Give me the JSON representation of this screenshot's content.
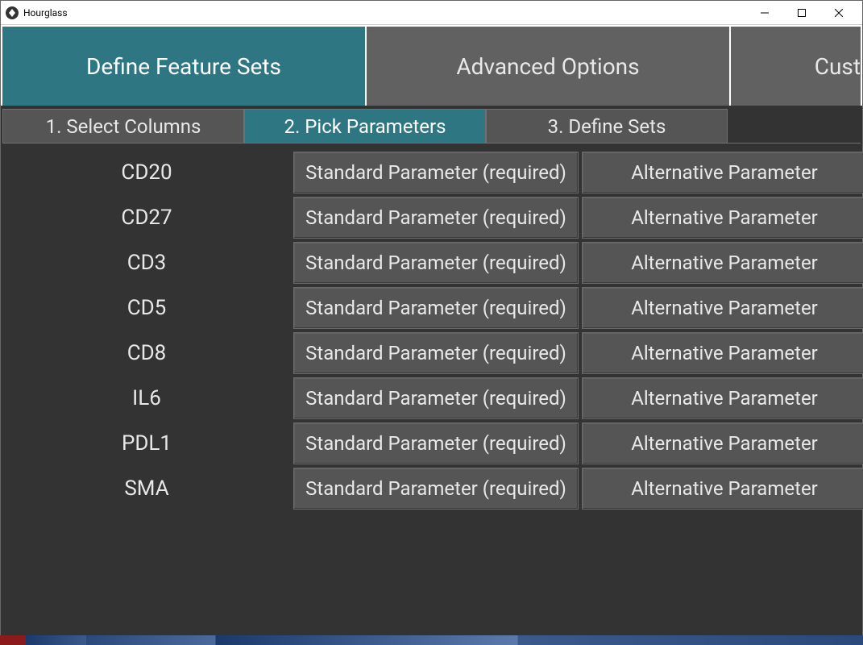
{
  "window": {
    "title": "Hourglass"
  },
  "main_tabs": [
    {
      "label": "Define Feature Sets",
      "active": true
    },
    {
      "label": "Advanced Options",
      "active": false
    },
    {
      "label": "Cust",
      "active": false,
      "cut": true
    }
  ],
  "step_tabs": [
    {
      "label": "1. Select Columns",
      "active": false
    },
    {
      "label": "2. Pick Parameters",
      "active": true
    },
    {
      "label": "3. Define Sets",
      "active": false
    }
  ],
  "std_label": "Standard Parameter (required)",
  "alt_label": "Alternative Parameter",
  "params": [
    {
      "name": "CD20"
    },
    {
      "name": "CD27"
    },
    {
      "name": "CD3"
    },
    {
      "name": "CD5"
    },
    {
      "name": "CD8"
    },
    {
      "name": "IL6"
    },
    {
      "name": "PDL1"
    },
    {
      "name": "SMA"
    }
  ]
}
